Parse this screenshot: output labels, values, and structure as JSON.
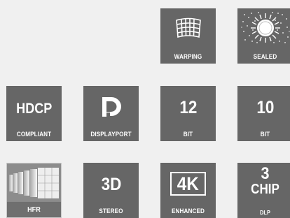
{
  "colors": {
    "tile": "#666666",
    "tile_hfr": "#8a8a8a",
    "text": "#ffffff",
    "background": "#f0f0f0"
  },
  "tiles": {
    "warping": {
      "icon": "grid-warp-icon",
      "sub": "WARPING"
    },
    "sealed": {
      "icon": "sealed-light-engine-icon",
      "sub": "SEALED"
    },
    "hdcp": {
      "main": "HDCP",
      "sub": "COMPLIANT"
    },
    "dp": {
      "icon": "displayport-logo-icon",
      "sub": "DISPLAYPORT"
    },
    "bit12": {
      "main": "12",
      "sub": "BIT"
    },
    "bit10": {
      "main": "10",
      "sub": "BIT"
    },
    "hfr": {
      "icon": "hfr-frames-icon",
      "sub": "HFR"
    },
    "stereo": {
      "main": "3D",
      "sub": "STEREO"
    },
    "k4": {
      "main": "4K",
      "sub": "ENHANCED"
    },
    "chip3": {
      "main": "3",
      "main2": "CHIP",
      "sub": "DLP"
    }
  }
}
